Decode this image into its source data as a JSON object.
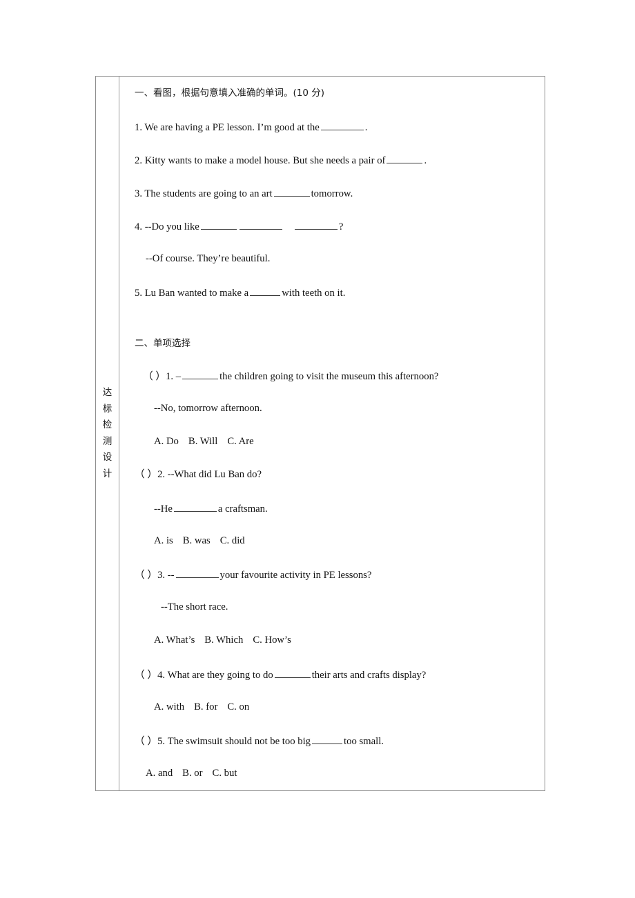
{
  "document": {
    "sidebar_label": "达标检测设计",
    "sidebar_chars": [
      "达",
      "标",
      "检",
      "测",
      "设",
      "计"
    ]
  },
  "section_one": {
    "heading_text": "一、看图，根据句意填入准确的单词。",
    "heading_score": "(10 分)",
    "questions": [
      {
        "number": "1.",
        "before": "1. We are having a PE lesson. I’m good at the",
        "after": "."
      },
      {
        "number": "2.",
        "before": "2. Kitty wants to make a model house. But she needs a pair of",
        "after": "."
      },
      {
        "number": "3.",
        "before": "3. The students are going to an art",
        "after": "tomorrow."
      },
      {
        "number": "4.",
        "before": "4. --Do you like",
        "after": "?",
        "answer_line": "--Of course. They’re beautiful."
      },
      {
        "number": "5.",
        "before": "5. Lu Ban wanted to make a",
        "after": "with teeth on it."
      }
    ]
  },
  "section_two": {
    "heading_text": "二、单项选择",
    "questions": [
      {
        "bracket": "（  ）",
        "stem_before": "1. –",
        "stem_after": "the children going to visit the museum this afternoon?",
        "reply": "--No, tomorrow afternoon.",
        "options": [
          "A. Do",
          "B. Will",
          "C. Are"
        ]
      },
      {
        "bracket": "（  ）",
        "stem_before": "2. --What did Lu Ban do?",
        "stem_after": "",
        "reply_before": "--He",
        "reply_after": "a craftsman.",
        "options": [
          "A. is",
          "B. was",
          "C. did"
        ]
      },
      {
        "bracket": "（  ）",
        "stem_before": "3. --",
        "stem_after": "your favourite activity in PE lessons?",
        "reply": "--The short race.",
        "options": [
          "A. What’s",
          "B. Which",
          "C. How’s"
        ]
      },
      {
        "bracket": "（  ）",
        "stem_before": "4. What are they going to do",
        "stem_after": "their arts and crafts display?",
        "options": [
          "A. with",
          "B. for",
          "C. on"
        ]
      },
      {
        "bracket": "（  ）",
        "stem_before": "5. The swimsuit should not be too big",
        "stem_after": "too small.",
        "options": [
          "A. and",
          "B. or",
          "C. but"
        ]
      }
    ]
  },
  "colors": {
    "text": "#111111",
    "border": "#8c8c8c",
    "blank_rule": "#3a3a3a",
    "page_background": "#ffffff"
  }
}
